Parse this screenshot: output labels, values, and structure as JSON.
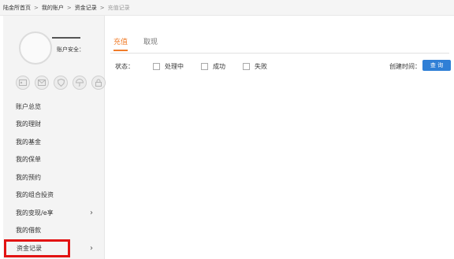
{
  "breadcrumb": {
    "items": [
      "陆金所首页",
      "我的账户",
      "资金记录"
    ],
    "current": "充值记录",
    "separator": ">"
  },
  "profile": {
    "security_label": "账户安全："
  },
  "badges": [
    "id-card-icon",
    "mail-icon",
    "shield-icon",
    "umbrella-icon",
    "lock-icon"
  ],
  "menu": {
    "items": [
      {
        "label": "账户总览"
      },
      {
        "label": "我的理财"
      },
      {
        "label": "我的基金"
      },
      {
        "label": "我的保单"
      },
      {
        "label": "我的预约"
      },
      {
        "label": "我的组合投资"
      },
      {
        "label": "我的变现/e享"
      },
      {
        "label": "我的借款"
      },
      {
        "label": "资金记录"
      }
    ]
  },
  "tabs": [
    {
      "label": "充值"
    },
    {
      "label": "取现"
    }
  ],
  "filters": {
    "status_label": "状态：",
    "options": [
      "处理中",
      "成功",
      "失败"
    ],
    "time_label": "创建时间：",
    "query_button": "查 询"
  },
  "colors": {
    "accent": "#f07c2a",
    "button": "#2f7fd6",
    "highlight_box": "#e21212"
  }
}
